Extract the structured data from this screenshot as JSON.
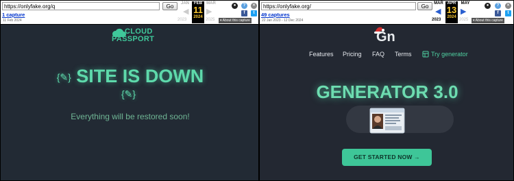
{
  "left": {
    "wayback": {
      "url": "https://onlyfake.org/q",
      "go_label": "Go",
      "captures_link": "1 capture",
      "date_range": "11 Feb 2024",
      "months": {
        "prev": "JAN",
        "current": "FEB",
        "next": "MAR"
      },
      "day": "11",
      "year_current": "2024",
      "year_prev": "2023",
      "year_next": "2025",
      "about_label": "About this capture"
    },
    "brand": {
      "line1": "CLOUD",
      "line2": "PASSPORT"
    },
    "headline": "SITE IS DOWN",
    "brace_glyph": "{✎}",
    "message": "Everything will be restored soon!"
  },
  "right": {
    "wayback": {
      "url": "https://onlyfake.org/",
      "go_label": "Go",
      "captures_link": "49 captures",
      "date_range": "22 Jan 2023 - 12 Dec 2024",
      "months": {
        "prev": "MAR",
        "current": "APR",
        "next": "MAY"
      },
      "day": "13",
      "year_current": "2024",
      "year_prev": "2023",
      "year_next": "2025",
      "about_label": "About this capture"
    },
    "logo": "Gn",
    "nav": {
      "features": "Features",
      "pricing": "Pricing",
      "faq": "FAQ",
      "terms": "Terms",
      "try": "Try generator"
    },
    "headline": "GENERATOR 3.0",
    "cta_label": "GET STARTED NOW →"
  },
  "colors": {
    "accent": "#5ed9ab",
    "cta": "#3ec698"
  }
}
